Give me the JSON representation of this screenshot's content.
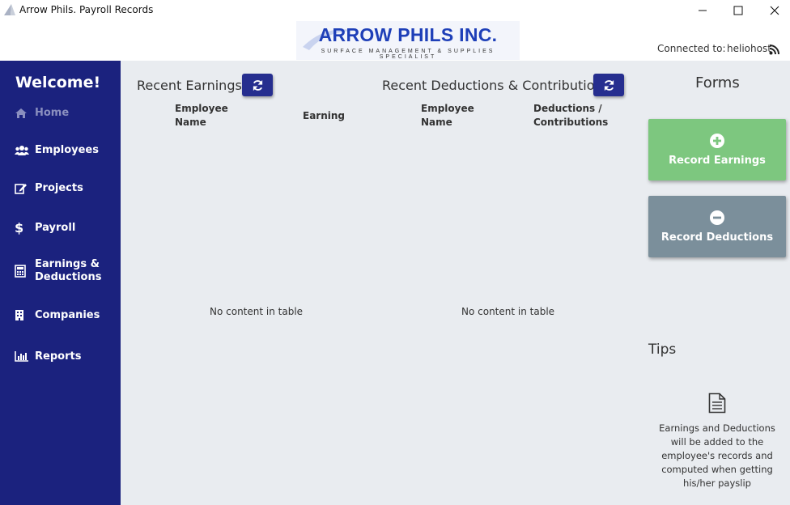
{
  "window": {
    "title": "Arrow Phils. Payroll Records",
    "minimize_icon": "minimize-icon",
    "maximize_icon": "maximize-icon",
    "close_icon": "close-icon"
  },
  "header": {
    "logo_main": "ARROW PHILS INC.",
    "logo_sub": "SURFACE MANAGEMENT & SUPPLIES SPECIALIST",
    "connected_label": "Connected to:",
    "host": "heliohost",
    "rss_icon": "rss-icon"
  },
  "sidebar": {
    "welcome": "Welcome!",
    "items": [
      {
        "label": "Home",
        "icon": "home-icon",
        "active": true
      },
      {
        "label": "Employees",
        "icon": "users-icon"
      },
      {
        "label": "Projects",
        "icon": "edit-icon"
      },
      {
        "label": "Payroll",
        "icon": "dollar-icon"
      },
      {
        "label": "Earnings & Deductions",
        "icon": "calculator-icon"
      },
      {
        "label": "Companies",
        "icon": "building-icon"
      },
      {
        "label": "Reports",
        "icon": "bar-chart-icon"
      }
    ]
  },
  "earnings": {
    "title": "Recent Earnings",
    "col1": "Employee Name",
    "col2": "Earning",
    "empty": "No content in table"
  },
  "deductions": {
    "title": "Recent Deductions & Contributions",
    "col1": "Employee Name",
    "col2": "Deductions / Contributions",
    "empty": "No content in table"
  },
  "forms": {
    "title": "Forms",
    "record_earnings": "Record Earnings",
    "record_deductions": "Record Deductions"
  },
  "tips": {
    "title": "Tips",
    "text": "Earnings and Deductions will be added to the employee's records and computed when getting his/her payslip"
  },
  "colors": {
    "sidebar": "#1b227e",
    "button": "#262e8f",
    "earnings_card": "#7dc77f",
    "deductions_card": "#7b8f9b",
    "main_bg": "#e9ecf0"
  }
}
